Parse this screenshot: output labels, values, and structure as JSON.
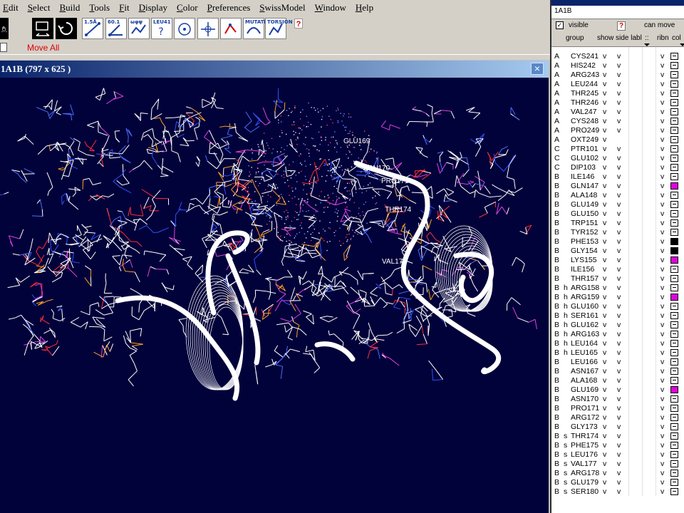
{
  "menu": [
    "Edit",
    "Select",
    "Build",
    "Tools",
    "Fit",
    "Display",
    "Color",
    "Preferences",
    "SwissModel",
    "Window",
    "Help"
  ],
  "toolbar": {
    "buttons": [
      {
        "name": "hand-move-icon",
        "label": ""
      },
      {
        "name": "screen-move-icon",
        "label": ""
      },
      {
        "name": "rotate-icon",
        "label": ""
      },
      {
        "name": "distance-icon",
        "label": "1.5Å"
      },
      {
        "name": "angle-icon",
        "label": "60.1"
      },
      {
        "name": "torsion-angle-icon",
        "label": "ωφψ"
      },
      {
        "name": "label-residue-icon",
        "label": "LEU41"
      },
      {
        "name": "center-view-icon",
        "label": ""
      },
      {
        "name": "neighbor-icon",
        "label": ""
      },
      {
        "name": "mutate-arrows-icon",
        "label": ""
      },
      {
        "name": "mutate-icon",
        "label": "MUTATE"
      },
      {
        "name": "torsion-icon",
        "label": "TORSION"
      }
    ],
    "help_q": "?"
  },
  "move_all": "Move All",
  "viewer": {
    "title": "1A1B   (797 x 625 )",
    "close": "×",
    "labels": [
      "GLU169",
      "ASN170",
      "PRO171",
      "THR174",
      "VAL177"
    ]
  },
  "panel": {
    "title": "1A1B",
    "visible_label": "visible",
    "visible_check": "✓",
    "help_q": "?",
    "can_move": "can move",
    "headers": [
      "group",
      "show side labl",
      "::",
      "ribn",
      "col"
    ],
    "accent_magenta": "#e000e0",
    "accent_black": "#000000",
    "residues": [
      {
        "chain": "A",
        "ss": "",
        "name": "CYS241",
        "v1": "v",
        "v2": "v",
        "v3": "v",
        "box": "dash"
      },
      {
        "chain": "A",
        "ss": "",
        "name": "HIS242",
        "v1": "v",
        "v2": "v",
        "v3": "v",
        "box": "dash"
      },
      {
        "chain": "A",
        "ss": "",
        "name": "ARG243",
        "v1": "v",
        "v2": "v",
        "v3": "v",
        "box": "dash"
      },
      {
        "chain": "A",
        "ss": "",
        "name": "LEU244",
        "v1": "v",
        "v2": "v",
        "v3": "v",
        "box": "dash"
      },
      {
        "chain": "A",
        "ss": "",
        "name": "THR245",
        "v1": "v",
        "v2": "v",
        "v3": "v",
        "box": "dash"
      },
      {
        "chain": "A",
        "ss": "",
        "name": "THR246",
        "v1": "v",
        "v2": "v",
        "v3": "v",
        "box": "dash"
      },
      {
        "chain": "A",
        "ss": "",
        "name": "VAL247",
        "v1": "v",
        "v2": "v",
        "v3": "v",
        "box": "dash"
      },
      {
        "chain": "A",
        "ss": "",
        "name": "CYS248",
        "v1": "v",
        "v2": "v",
        "v3": "v",
        "box": "dash"
      },
      {
        "chain": "A",
        "ss": "",
        "name": "PRO249",
        "v1": "v",
        "v2": "v",
        "v3": "v",
        "box": "dash"
      },
      {
        "chain": "A",
        "ss": "",
        "name": "OXT249",
        "v1": "v",
        "v2": "",
        "v3": "v",
        "box": "dash"
      },
      {
        "chain": "C",
        "ss": "",
        "name": "PTR101",
        "v1": "v",
        "v2": "v",
        "v3": "v",
        "box": "dash"
      },
      {
        "chain": "C",
        "ss": "",
        "name": "GLU102",
        "v1": "v",
        "v2": "v",
        "v3": "v",
        "box": "dash"
      },
      {
        "chain": "C",
        "ss": "",
        "name": "DIP103",
        "v1": "v",
        "v2": "v",
        "v3": "v",
        "box": "dash"
      },
      {
        "chain": "B",
        "ss": "",
        "name": "ILE146",
        "v1": "v",
        "v2": "v",
        "v3": "v",
        "box": "dash"
      },
      {
        "chain": "B",
        "ss": "",
        "name": "GLN147",
        "v1": "v",
        "v2": "v",
        "v3": "v",
        "box": "magenta"
      },
      {
        "chain": "B",
        "ss": "",
        "name": "ALA148",
        "v1": "v",
        "v2": "v",
        "v3": "v",
        "box": "dash"
      },
      {
        "chain": "B",
        "ss": "",
        "name": "GLU149",
        "v1": "v",
        "v2": "v",
        "v3": "v",
        "box": "dash"
      },
      {
        "chain": "B",
        "ss": "",
        "name": "GLU150",
        "v1": "v",
        "v2": "v",
        "v3": "v",
        "box": "dash"
      },
      {
        "chain": "B",
        "ss": "",
        "name": "TRP151",
        "v1": "v",
        "v2": "v",
        "v3": "v",
        "box": "dash"
      },
      {
        "chain": "B",
        "ss": "",
        "name": "TYR152",
        "v1": "v",
        "v2": "v",
        "v3": "v",
        "box": "dash"
      },
      {
        "chain": "B",
        "ss": "",
        "name": "PHE153",
        "v1": "v",
        "v2": "v",
        "v3": "v",
        "box": "black"
      },
      {
        "chain": "B",
        "ss": "",
        "name": "GLY154",
        "v1": "v",
        "v2": "v",
        "v3": "v",
        "box": "black"
      },
      {
        "chain": "B",
        "ss": "",
        "name": "LYS155",
        "v1": "v",
        "v2": "v",
        "v3": "v",
        "box": "magenta"
      },
      {
        "chain": "B",
        "ss": "",
        "name": "ILE156",
        "v1": "v",
        "v2": "v",
        "v3": "v",
        "box": "dash"
      },
      {
        "chain": "B",
        "ss": "",
        "name": "THR157",
        "v1": "v",
        "v2": "v",
        "v3": "v",
        "box": "dash"
      },
      {
        "chain": "B",
        "ss": "h",
        "name": "ARG158",
        "v1": "v",
        "v2": "v",
        "v3": "v",
        "box": "dash"
      },
      {
        "chain": "B",
        "ss": "h",
        "name": "ARG159",
        "v1": "v",
        "v2": "v",
        "v3": "v",
        "box": "magenta"
      },
      {
        "chain": "B",
        "ss": "h",
        "name": "GLU160",
        "v1": "v",
        "v2": "v",
        "v3": "v",
        "box": "dash"
      },
      {
        "chain": "B",
        "ss": "h",
        "name": "SER161",
        "v1": "v",
        "v2": "v",
        "v3": "v",
        "box": "dash"
      },
      {
        "chain": "B",
        "ss": "h",
        "name": "GLU162",
        "v1": "v",
        "v2": "v",
        "v3": "v",
        "box": "dash"
      },
      {
        "chain": "B",
        "ss": "h",
        "name": "ARG163",
        "v1": "v",
        "v2": "v",
        "v3": "v",
        "box": "dash"
      },
      {
        "chain": "B",
        "ss": "h",
        "name": "LEU164",
        "v1": "v",
        "v2": "v",
        "v3": "v",
        "box": "dash"
      },
      {
        "chain": "B",
        "ss": "h",
        "name": "LEU165",
        "v1": "v",
        "v2": "v",
        "v3": "v",
        "box": "dash"
      },
      {
        "chain": "B",
        "ss": "",
        "name": "LEU166",
        "v1": "v",
        "v2": "v",
        "v3": "v",
        "box": "dash"
      },
      {
        "chain": "B",
        "ss": "",
        "name": "ASN167",
        "v1": "v",
        "v2": "v",
        "v3": "v",
        "box": "dash"
      },
      {
        "chain": "B",
        "ss": "",
        "name": "ALA168",
        "v1": "v",
        "v2": "v",
        "v3": "v",
        "box": "dash"
      },
      {
        "chain": "B",
        "ss": "",
        "name": "GLU169",
        "v1": "v",
        "v2": "v",
        "v3": "v",
        "box": "magenta"
      },
      {
        "chain": "B",
        "ss": "",
        "name": "ASN170",
        "v1": "v",
        "v2": "v",
        "v3": "v",
        "box": "dash"
      },
      {
        "chain": "B",
        "ss": "",
        "name": "PRO171",
        "v1": "v",
        "v2": "v",
        "v3": "v",
        "box": "dash"
      },
      {
        "chain": "B",
        "ss": "",
        "name": "ARG172",
        "v1": "v",
        "v2": "v",
        "v3": "v",
        "box": "dash"
      },
      {
        "chain": "B",
        "ss": "",
        "name": "GLY173",
        "v1": "v",
        "v2": "v",
        "v3": "v",
        "box": "dash"
      },
      {
        "chain": "B",
        "ss": "s",
        "name": "THR174",
        "v1": "v",
        "v2": "v",
        "v3": "v",
        "box": "dash"
      },
      {
        "chain": "B",
        "ss": "s",
        "name": "PHE175",
        "v1": "v",
        "v2": "v",
        "v3": "v",
        "box": "dash"
      },
      {
        "chain": "B",
        "ss": "s",
        "name": "LEU176",
        "v1": "v",
        "v2": "v",
        "v3": "v",
        "box": "dash"
      },
      {
        "chain": "B",
        "ss": "s",
        "name": "VAL177",
        "v1": "v",
        "v2": "v",
        "v3": "v",
        "box": "dash"
      },
      {
        "chain": "B",
        "ss": "s",
        "name": "ARG178",
        "v1": "v",
        "v2": "v",
        "v3": "v",
        "box": "dash"
      },
      {
        "chain": "B",
        "ss": "s",
        "name": "GLU179",
        "v1": "v",
        "v2": "v",
        "v3": "v",
        "box": "dash"
      },
      {
        "chain": "B",
        "ss": "s",
        "name": "SER180",
        "v1": "v",
        "v2": "v",
        "v3": "v",
        "box": "dash"
      }
    ]
  }
}
